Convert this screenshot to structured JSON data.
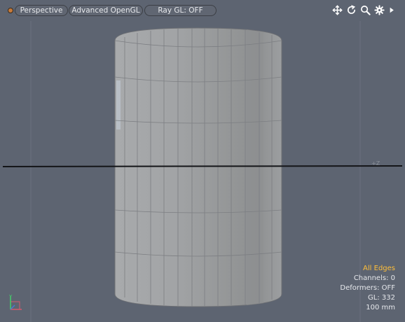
{
  "viewport": {
    "view_menu": "Perspective",
    "render_mode": "Advanced OpenGL",
    "raygl": "Ray GL: OFF"
  },
  "toolbar_icons": [
    "move-view-icon",
    "rotate-view-icon",
    "zoom-view-icon",
    "settings-gear-icon",
    "expand-arrow-icon"
  ],
  "axis_labels": {
    "horizon_tag": "+Z"
  },
  "stats": {
    "selection_mode": "All Edges",
    "channels": "Channels: 0",
    "deformers": "Deformers: OFF",
    "gl": "GL: 332",
    "grid_unit": "100 mm"
  },
  "colors": {
    "background": "#5d6471",
    "highlight": "#ffbf3a",
    "mesh": "#9fa2a5"
  }
}
